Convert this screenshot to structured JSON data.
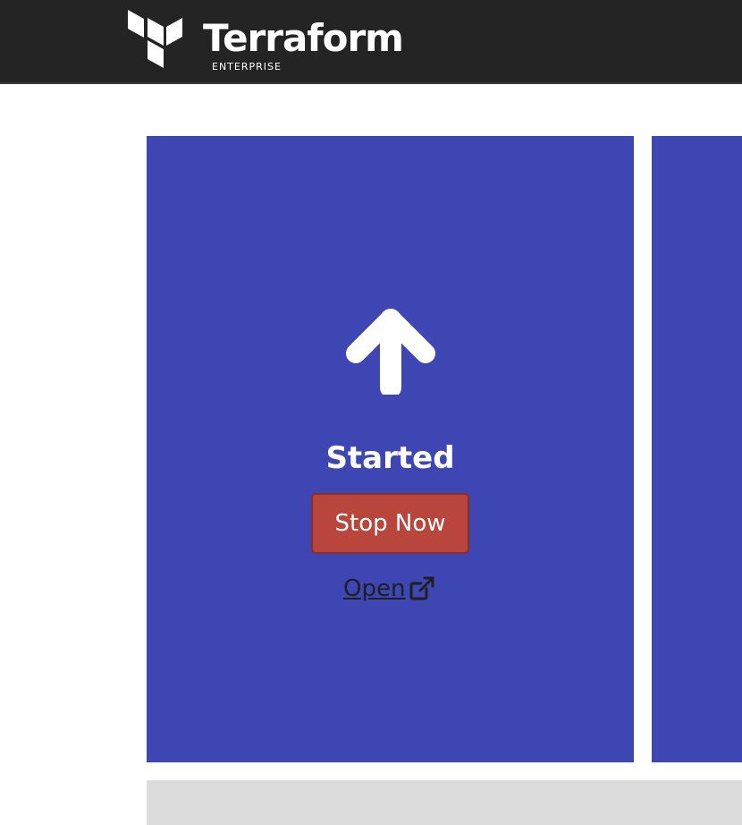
{
  "header": {
    "brand_name": "Terraform",
    "brand_sub": "ENTERPRISE",
    "background": "#242424"
  },
  "card": {
    "background": "#3d46b3",
    "status_icon": "arrow-up-icon",
    "status_label": "Started",
    "stop_button_label": "Stop Now",
    "stop_button_color": "#b8463c",
    "open_link_label": "Open ",
    "open_link_icon": "external-link-icon"
  }
}
